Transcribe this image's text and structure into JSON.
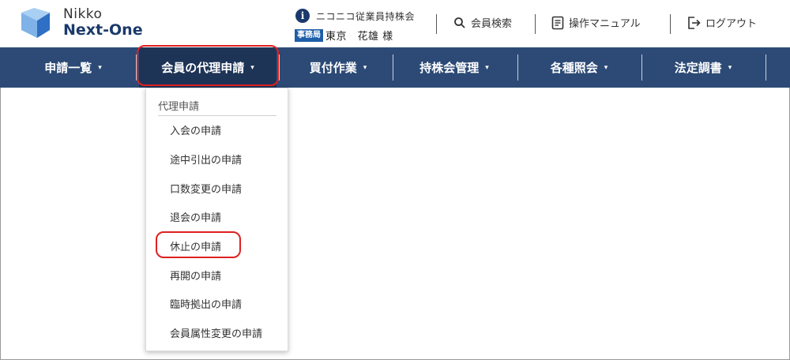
{
  "brand": {
    "line1": "Nikko",
    "line2": "Next-One"
  },
  "company": {
    "name": "ニコニコ従業員持株会"
  },
  "member": {
    "badge": "事務局",
    "name": "東京　花雄 様"
  },
  "header_actions": {
    "search_label": "会員検索",
    "manual_label": "操作マニュアル",
    "logout_label": "ログアウト"
  },
  "nav": {
    "items": [
      {
        "label": "申請一覧"
      },
      {
        "label": "会員の代理申請"
      },
      {
        "label": "買付作業"
      },
      {
        "label": "持株会管理"
      },
      {
        "label": "各種照会"
      },
      {
        "label": "法定調書"
      }
    ],
    "caret": "▾"
  },
  "dropdown": {
    "header": "代理申請",
    "items": [
      {
        "label": "入会の申請"
      },
      {
        "label": "途中引出の申請"
      },
      {
        "label": "口数変更の申請"
      },
      {
        "label": "退会の申請"
      },
      {
        "label": "休止の申請"
      },
      {
        "label": "再開の申請"
      },
      {
        "label": "臨時拠出の申請"
      },
      {
        "label": "会員属性変更の申請"
      }
    ]
  },
  "colors": {
    "navbar": "#2c4a75",
    "brand_dark": "#1b3a6b",
    "logo_light": "#7fb3e8",
    "logo_dark": "#2f6fc4",
    "badge": "#1f5ea8",
    "highlight": "#e02020"
  },
  "icons": {
    "info": "info-icon",
    "search": "search-icon",
    "manual": "document-icon",
    "logout": "logout-icon",
    "logo": "nikko-logo"
  }
}
